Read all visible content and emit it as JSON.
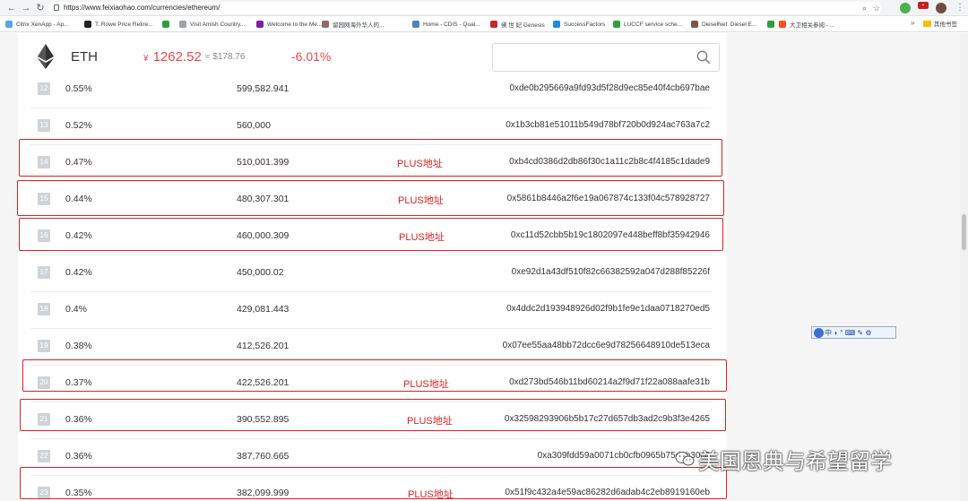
{
  "browser": {
    "url": "https://www.feixiaohao.com/currencies/ethereum/",
    "bookmarks": [
      {
        "label": "Citrix XenApp - Ap...",
        "color": "#5aa3ee"
      },
      {
        "label": "T. Rowe Price Retire...",
        "color": "#222222"
      },
      {
        "label": "",
        "color": "#2e9e3c"
      },
      {
        "label": "Visit Amish Country...",
        "color": "#9aa0a6"
      },
      {
        "label": "Welcome to the Me...",
        "color": "#7b1fa2"
      },
      {
        "label": "留园网海外华人的...",
        "color": "#8d6e63"
      },
      {
        "label": "Home - CDIS - Qual...",
        "color": "#4f7fc7"
      },
      {
        "label": "佛 世 妃 Genesis",
        "color": "#c62828"
      },
      {
        "label": "SuccessFactors",
        "color": "#1e88e5"
      },
      {
        "label": "LUCCF service sche...",
        "color": "#2e9e3c"
      },
      {
        "label": "DieselNet: Diesel E...",
        "color": "#795548"
      },
      {
        "label": "",
        "color": "#2e9e3c"
      },
      {
        "label": "大卫相关参阅 - ...",
        "color": "#f4511e"
      }
    ],
    "more": "»",
    "other_bookmarks": "其他书签"
  },
  "header": {
    "symbol": "ETH",
    "currency_symbol": "¥",
    "price_cny": "1262.52",
    "price_usd": "≈ $178.76",
    "change": "-6.01%",
    "search_placeholder": ""
  },
  "rows": [
    {
      "rank": "12",
      "pct": "0.55%",
      "qty": "599,582.941",
      "tag": "",
      "address": "0xde0b295669a9fd93d5f28d9ec85e40f4cb697bae"
    },
    {
      "rank": "13",
      "pct": "0.52%",
      "qty": "560,000",
      "tag": "",
      "address": "0x1b3cb81e51011b549d78bf720b0d924ac763a7c2"
    },
    {
      "rank": "14",
      "pct": "0.47%",
      "qty": "510,001.399",
      "tag": "PLUS地址",
      "address": "0xb4cd0386d2db86f30c1a11c2b8c4f4185c1dade9"
    },
    {
      "rank": "15",
      "pct": "0.44%",
      "qty": "480,307.301",
      "tag": "PLUS地址",
      "address": "0x5861b8446a2f6e19a067874c133f04c578928727"
    },
    {
      "rank": "16",
      "pct": "0.42%",
      "qty": "460,000.309",
      "tag": "PLUS地址",
      "address": "0xc11d52cbb5b19c1802097e448beff8bf35942946"
    },
    {
      "rank": "17",
      "pct": "0.42%",
      "qty": "450,000.02",
      "tag": "",
      "address": "0xe92d1a43df510f82c66382592a047d288f85226f"
    },
    {
      "rank": "18",
      "pct": "0.4%",
      "qty": "429,081.443",
      "tag": "",
      "address": "0x4ddc2d193948926d02f9b1fe9e1daa0718270ed5"
    },
    {
      "rank": "19",
      "pct": "0.38%",
      "qty": "412,526.201",
      "tag": "",
      "address": "0x07ee55aa48bb72dcc6e9d78256648910de513eca"
    },
    {
      "rank": "20",
      "pct": "0.37%",
      "qty": "422,526.201",
      "tag": "PLUS地址",
      "address": "0xd273bd546b11bd60214a2f9d71f22a088aafe31b"
    },
    {
      "rank": "21",
      "pct": "0.36%",
      "qty": "390,552.895",
      "tag": "PLUS地址",
      "address": "0x32598293906b5b17c27d657db3ad2c9b3f3e4265"
    },
    {
      "rank": "22",
      "pct": "0.36%",
      "qty": "387,760.665",
      "tag": "",
      "address": "0xa309fdd59a0071cb0cfb0965b75d8b30c8"
    },
    {
      "rank": "23",
      "pct": "0.35%",
      "qty": "382,099.999",
      "tag": "PLUS地址",
      "address": "0x51f9c432a4e59ac86282d6adab4c2eb8919160eb"
    }
  ],
  "ime_toolbar": "中 ◗ ° ⌨ ✎ ⚙",
  "watermark": "美国恩典与希望留学",
  "colors": {
    "accent_red": "#e02020",
    "price_red": "#e84a4a"
  }
}
